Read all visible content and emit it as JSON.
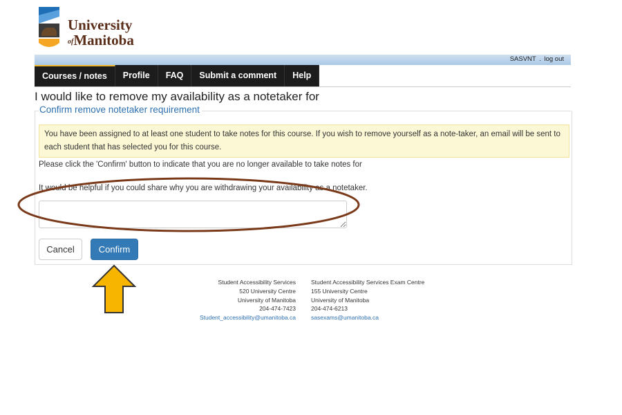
{
  "logo": {
    "name_line1": "University",
    "name_of": "of",
    "name_line2": "Manitoba",
    "colors": {
      "text": "#5a2d18",
      "blue": "#1f6fb6",
      "gold": "#f5a623",
      "dark": "#3a3a3a"
    }
  },
  "userbar": {
    "user": "SASVNT",
    "separator": ".",
    "logout": "log out"
  },
  "nav": {
    "tabs": [
      {
        "label": "Courses / notes",
        "active": true
      },
      {
        "label": "Profile",
        "active": false
      },
      {
        "label": "FAQ",
        "active": false
      },
      {
        "label": "Submit a comment",
        "active": false
      },
      {
        "label": "Help",
        "active": false
      }
    ]
  },
  "page_title": "I would like to remove my availability as a notetaker for",
  "panel_title": "Confirm remove notetaker requirement",
  "alert_text": "You have been assigned to at least one student to take notes for this course. If you wish to remove yourself as a note-taker, an email will be sent to each student that has selected you for this course.",
  "confirm_instruction": "Please click the 'Confirm' button to indicate that you are no longer available to take notes for",
  "reason_prompt": "It would be helpful if you could share why you are withdrawing your availability as a notetaker.",
  "reason_value": "",
  "buttons": {
    "cancel": "Cancel",
    "confirm": "Confirm"
  },
  "annotations": {
    "ellipse_color": "#7a3a1a",
    "arrow_color": "#f7b500"
  },
  "footer": {
    "left": {
      "line1": "Student Accessibility Services",
      "line2": "520 University Centre",
      "line3": "University of Manitoba",
      "phone": "204-474-7423",
      "email": "Student_accessibility@umanitoba.ca"
    },
    "right": {
      "line1": "Student Accessibility Services Exam Centre",
      "line2": "155 University Centre",
      "line3": "University of Manitoba",
      "phone": "204-474-6213",
      "email": "sasexams@umanitoba.ca"
    }
  }
}
